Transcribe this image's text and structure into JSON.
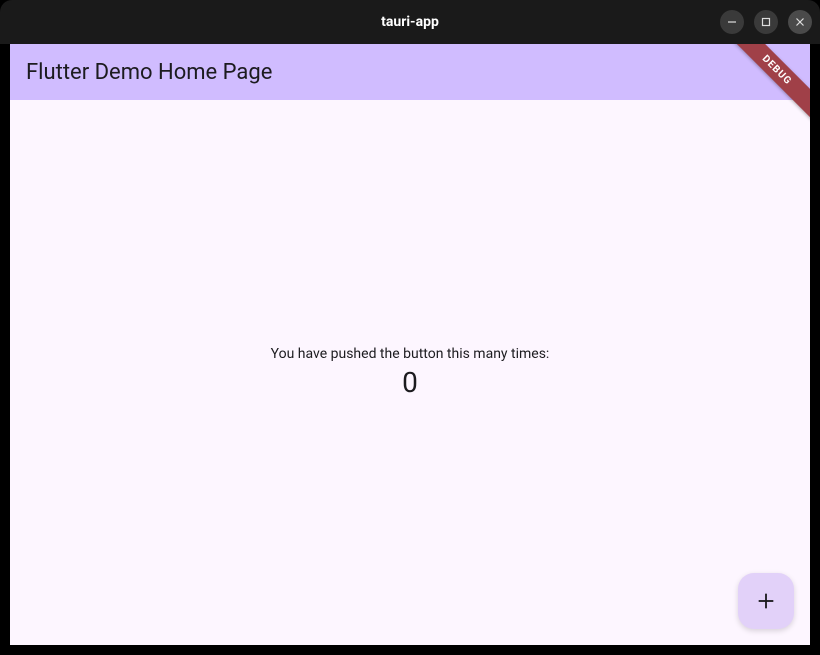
{
  "window": {
    "title": "tauri-app"
  },
  "appbar": {
    "title": "Flutter Demo Home Page"
  },
  "body": {
    "prompt_text": "You have pushed the button this many times:",
    "counter_value": "0"
  },
  "debug": {
    "label": "DEBUG"
  },
  "colors": {
    "titlebar_bg": "#1a1a1a",
    "appbar_bg": "#d0bcff",
    "surface_bg": "#fdf6ff",
    "fab_bg": "#e2d1f9",
    "debug_bg": "#a04048"
  }
}
